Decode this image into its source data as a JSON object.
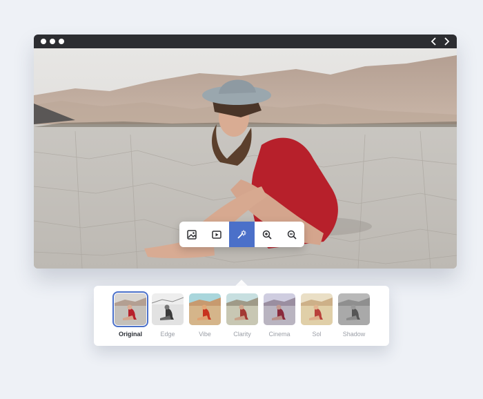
{
  "window": {
    "nav_back": "chevron-left-icon",
    "nav_forward": "chevron-right-icon"
  },
  "toolbar": {
    "tools": [
      {
        "icon": "image-icon"
      },
      {
        "icon": "play-icon"
      },
      {
        "icon": "magic-wand-icon",
        "active": true
      },
      {
        "icon": "zoom-in-icon"
      },
      {
        "icon": "zoom-out-icon"
      }
    ]
  },
  "filters": {
    "items": [
      {
        "label": "Original"
      },
      {
        "label": "Edge"
      },
      {
        "label": "Vibe"
      },
      {
        "label": "Clarity"
      },
      {
        "label": "Cinema"
      },
      {
        "label": "Sol"
      },
      {
        "label": "Shadow"
      }
    ],
    "selected": "Original"
  },
  "colors": {
    "accent": "#4b70c9",
    "titlebar": "#2c2d31",
    "background": "#eef1f6"
  }
}
